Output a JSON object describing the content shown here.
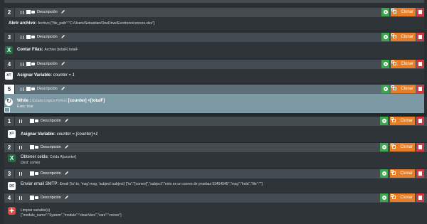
{
  "common": {
    "description_label": "Descripción",
    "clone_label": "Clonar"
  },
  "blocks": [
    {
      "number": "2",
      "action": "Abrir archivo:",
      "detail": "Archivo [\"file_path\":\"C:/Users/Sebastian/OneDrive/Escritorio/correos.xlsx\"]"
    },
    {
      "number": "3",
      "action": "Contar Filas:",
      "detail": "Archivo [totalF] totalF"
    },
    {
      "number": "4",
      "action": "Asignar Variable:",
      "detail": "counter = 1"
    },
    {
      "number": "5",
      "action": "While :",
      "detail": "Estado Lógica Python",
      "detail2": "[counter] <[totalF]",
      "sub": "Exec: true"
    },
    {
      "number": "1",
      "action": "Asignar Variable:",
      "detail": "counter = {counter}+1"
    },
    {
      "number": "2",
      "action": "Obtener celda:",
      "detail": "Celda A[counter]",
      "sub": "Dest: correo"
    },
    {
      "number": "3",
      "action": "Enviar email SMTP:",
      "detail": "Email {'to':to, 'msg':msg, 'subject':subject}",
      "detail2": "[\"to\":\"[correo]\",\"subject\":\"esto es un correo de pruebas 53454545\",\"msg\":\"hola\",\"file\":\"\"]"
    },
    {
      "number": "4",
      "action": "Limpiar variable(s)",
      "detail": "{\"module_name\":\"System\",\"module\":\"cleanVars\",\"vars\":\"correo\"}"
    }
  ]
}
